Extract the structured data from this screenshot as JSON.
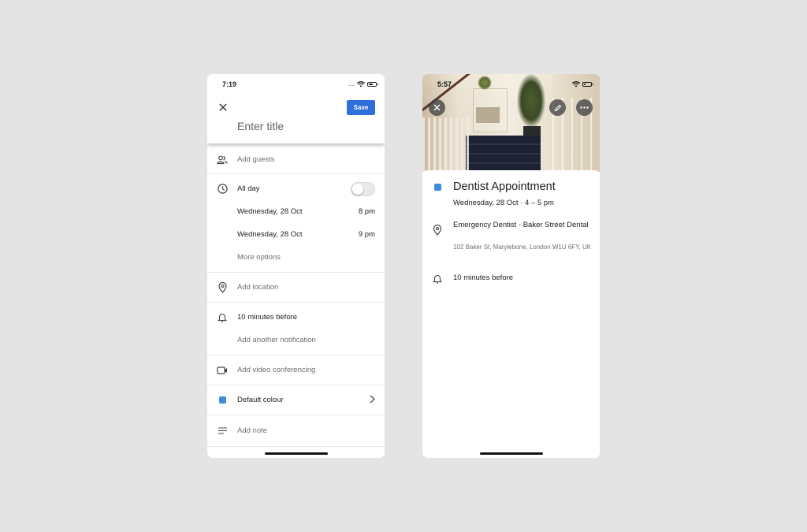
{
  "edit_screen": {
    "status_bar": {
      "time": "7:19",
      "signal": "....",
      "icons": [
        "wifi-icon",
        "battery-icon"
      ]
    },
    "header": {
      "close_icon": "close-icon",
      "save_label": "Save",
      "title_placeholder": "Enter title",
      "title_value": ""
    },
    "guests": {
      "icon": "people-icon",
      "label": "Add guests"
    },
    "time_section": {
      "icon": "clock-icon",
      "all_day_label": "All day",
      "all_day_enabled": false,
      "start": {
        "date": "Wednesday, 28 Oct",
        "time": "8 pm"
      },
      "end": {
        "date": "Wednesday, 28 Oct",
        "time": "9 pm"
      },
      "more_options": "More options"
    },
    "location": {
      "icon": "location-pin-icon",
      "label": "Add location"
    },
    "notifications": {
      "icon": "bell-icon",
      "current": "10 minutes before",
      "add_another": "Add another notification"
    },
    "video": {
      "icon": "video-camera-icon",
      "label": "Add video conferencing"
    },
    "colour": {
      "label": "Default colour",
      "swatch": "#3b8cdb",
      "icon": "chevron-right-icon"
    },
    "note": {
      "icon": "notes-icon",
      "label": "Add note"
    }
  },
  "detail_screen": {
    "status_bar": {
      "time": "5:57",
      "icons": [
        "wifi-icon",
        "battery-icon"
      ]
    },
    "actions": {
      "close": "close-icon",
      "edit": "pencil-icon",
      "more": "more-horizontal-icon"
    },
    "event": {
      "title": "Dentist Appointment",
      "datetime": "Wednesday, 28 Oct · 4 – 5 pm",
      "colour": "#3b8cdb"
    },
    "location": {
      "name": "Emergency Dentist - Baker Street Dental",
      "address": "102 Baker St, Marylebone, London W1U 6FY, UK"
    },
    "notification": "10 minutes before"
  },
  "colors": {
    "background": "#e4e4e4",
    "primary_button": "#2f6fdc",
    "event_colour": "#3b8cdb"
  }
}
